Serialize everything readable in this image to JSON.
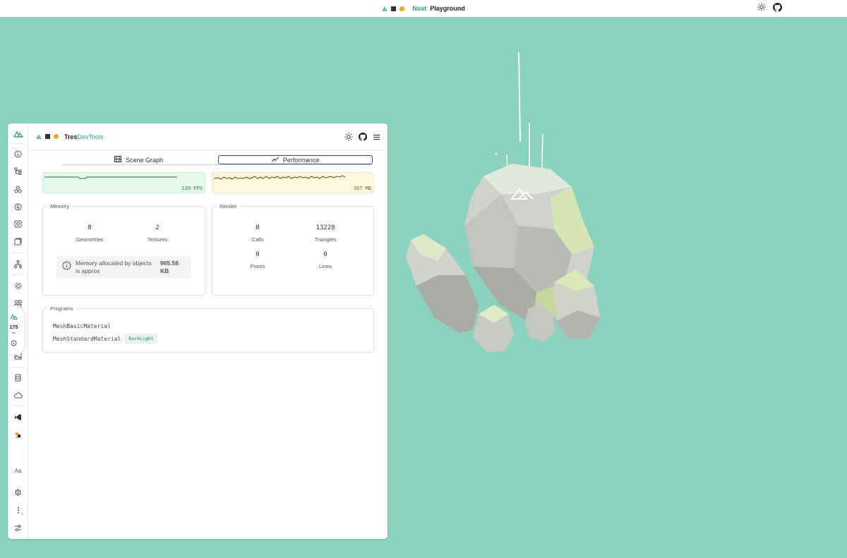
{
  "topbar": {
    "brand_nuxt": "Nuxt",
    "brand_playground": "Playground",
    "icons": [
      "sun-icon",
      "github-icon"
    ]
  },
  "devtools": {
    "title_part1": "Tres",
    "title_part2": "DevTools",
    "header_icons": [
      "sun-icon",
      "github-icon",
      "menu-icon"
    ],
    "tabs": [
      {
        "label": "Scene Graph",
        "icon": "film-icon",
        "active": false
      },
      {
        "label": "Performance",
        "icon": "chart-icon",
        "active": true
      }
    ],
    "fps_label": "120 FPS",
    "memory_label": "167 MB",
    "memory_panel": {
      "legend": "Memory",
      "geometries": {
        "value": "8",
        "label": "Geometries"
      },
      "textures": {
        "value": "2",
        "label": "Textures"
      },
      "info_text": "Memory allocated by objects is approx",
      "info_value": "965.58 KB"
    },
    "render_panel": {
      "legend": "Render",
      "calls": {
        "value": "8",
        "label": "Calls"
      },
      "triangles": {
        "value": "13228",
        "label": "Triangles"
      },
      "points": {
        "value": "0",
        "label": "Points"
      },
      "lines": {
        "value": "0",
        "label": "Lines"
      }
    },
    "programs_panel": {
      "legend": "Programs",
      "items": [
        {
          "name": "MeshBasicMaterial",
          "tag": ""
        },
        {
          "name": "MeshStandardMaterial",
          "tag": "RockLight"
        }
      ]
    }
  },
  "sidebar": {
    "ms_value": "175",
    "ms_unit": "ms",
    "font_label": "Aa",
    "badge": "4",
    "icons": [
      "nuxt-logo-icon",
      "info-icon",
      "tree-icon",
      "components-icon",
      "hooks-icon",
      "scene-icon",
      "assets-icon",
      "graph-icon",
      "settings-gear-icon",
      "modules-icon",
      "plug-icon",
      "timeline-icon",
      "image-icon",
      "storage-icon",
      "cloud-icon",
      "vscode-icon",
      "tres-icon",
      "font-icon",
      "bug-icon",
      "more-icon",
      "sliders-icon"
    ]
  },
  "colors": {
    "background": "#89d3bf",
    "accent": "#2f9e6f",
    "fps_bg": "#e6f6ea",
    "memory_bg": "#fdf7e1"
  }
}
